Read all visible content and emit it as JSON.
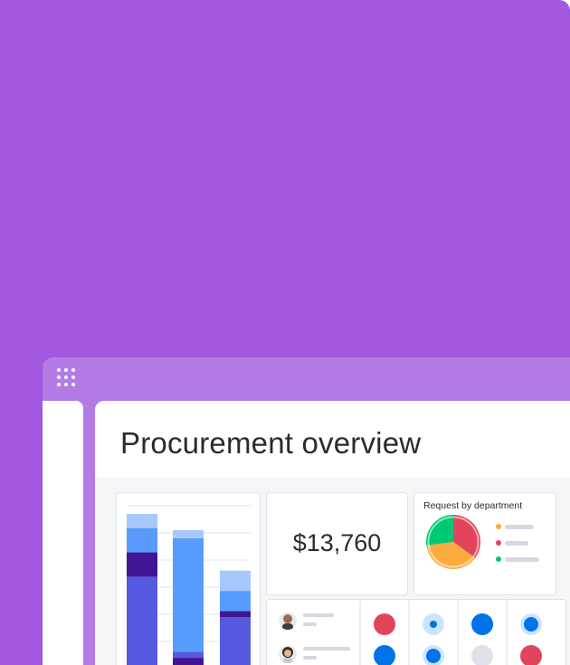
{
  "page": {
    "title": "Procurement overview"
  },
  "kpi": {
    "value": "$13,760"
  },
  "pie_card": {
    "title": "Request by department"
  },
  "icons": {
    "apps": "grid-dots-icon"
  },
  "colors": {
    "background": "#a258df",
    "window": "#b47be6",
    "bar_dark": "#5559df",
    "bar_mid": "#579bfc",
    "bar_light": "#a6c8ff",
    "bar_deep": "#401694",
    "pie_red": "#e2445c",
    "pie_orange": "#fdab3d",
    "pie_green": "#00c875",
    "status_blue": "#0073ea",
    "status_red": "#e2445c"
  },
  "chart_data": {
    "type": "bar",
    "stacked": true,
    "categories": [
      "",
      "",
      ""
    ],
    "series": [
      {
        "values": [
          48,
          8,
          28
        ]
      },
      {
        "values": [
          12,
          3,
          3
        ]
      },
      {
        "values": [
          12,
          56,
          10
        ]
      },
      {
        "values": [
          7,
          4,
          10
        ]
      }
    ],
    "ylim": [
      0,
      83
    ],
    "grid": true,
    "legend": "none"
  },
  "pie_data": {
    "type": "pie",
    "values": [
      35,
      38,
      27
    ]
  }
}
